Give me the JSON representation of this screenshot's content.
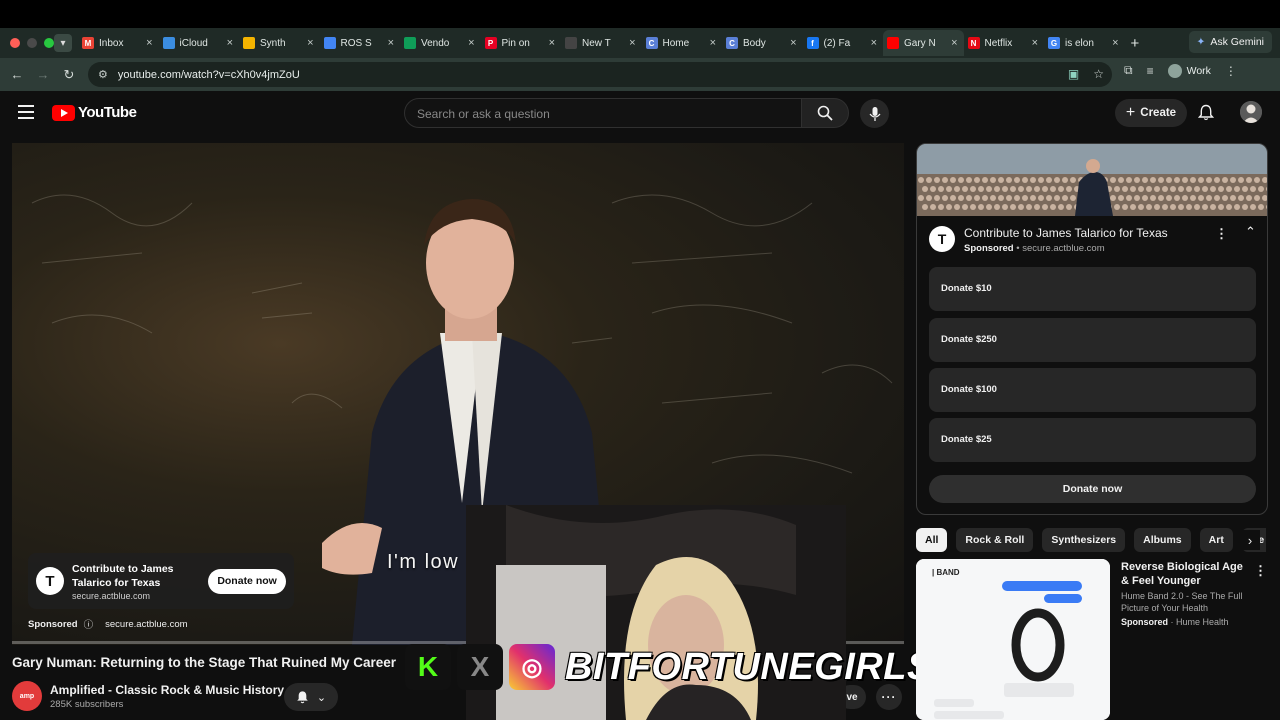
{
  "browser": {
    "tabs": [
      {
        "label": "Inbox",
        "icon": "gmail-icon",
        "color": "#ea4335",
        "glyph": "M"
      },
      {
        "label": "iCloud",
        "icon": "icloud-icon",
        "color": "#3b8de0",
        "glyph": ""
      },
      {
        "label": "Synth",
        "icon": "drive-icon",
        "color": "#f4b400",
        "glyph": ""
      },
      {
        "label": "ROS S",
        "icon": "docs-icon",
        "color": "#4285f4",
        "glyph": ""
      },
      {
        "label": "Vendo",
        "icon": "sheets-icon",
        "color": "#0f9d58",
        "glyph": ""
      },
      {
        "label": "Pin on",
        "icon": "pinterest-icon",
        "color": "#e60023",
        "glyph": "P"
      },
      {
        "label": "New T",
        "icon": "github-icon",
        "color": "#444444",
        "glyph": ""
      },
      {
        "label": "Home",
        "icon": "home-app-icon",
        "color": "#5a7fd6",
        "glyph": "C"
      },
      {
        "label": "Body",
        "icon": "body-app-icon",
        "color": "#5a7fd6",
        "glyph": "C"
      },
      {
        "label": "(2) Fa",
        "icon": "facebook-icon",
        "color": "#1877f2",
        "glyph": "f"
      },
      {
        "label": "Gary N",
        "icon": "youtube-icon",
        "color": "#ff0000",
        "glyph": "",
        "active": true
      },
      {
        "label": "Netflix",
        "icon": "netflix-icon",
        "color": "#e50914",
        "glyph": "N"
      },
      {
        "label": "is elon",
        "icon": "google-icon",
        "color": "#4285f4",
        "glyph": "G"
      }
    ],
    "ask_gemini": "Ask Gemini",
    "url": "youtube.com/watch?v=cXh0v4jmZoU",
    "profile_label": "Work"
  },
  "youtube": {
    "logo_text": "YouTube",
    "search_placeholder": "Search or ask a question",
    "create_label": "Create"
  },
  "video": {
    "caption": "I'm low",
    "overlay_ad": {
      "title": "Contribute to James Talarico for Texas",
      "domain": "secure.actblue.com",
      "button": "Donate now",
      "sponsored": "Sponsored",
      "sponsored_domain": "secure.actblue.com"
    },
    "title": "Gary Numan: Returning to the Stage That Ruined My Career",
    "channel": {
      "name": "Amplified - Classic Rock & Music History",
      "subscribers": "285K subscribers",
      "avatar_text": "amp"
    },
    "save_label": "ve"
  },
  "stream_overlay": {
    "brand": "BITFORTUNEGIRLS",
    "colors": {
      "kick": "#53fc18",
      "x": "#111111",
      "instagram": "#e1306c"
    }
  },
  "ad_panel": {
    "logo": "T",
    "title": "Contribute to James Talarico for Texas",
    "sponsored": "Sponsored",
    "domain": "secure.actblue.com",
    "options": [
      "Donate $10",
      "Donate $250",
      "Donate $100",
      "Donate $25"
    ],
    "donate_button": "Donate now"
  },
  "chips": [
    "All",
    "Rock & Roll",
    "Synthesizers",
    "Albums",
    "Art",
    "Re"
  ],
  "recommendation": {
    "thumb_brand": "| BAND",
    "title": "Reverse Biological Age & Feel Younger",
    "description": "Hume Band 2.0 - See The Full Picture of Your Health",
    "sponsored": "Sponsored",
    "advertiser": "Hume Health"
  }
}
